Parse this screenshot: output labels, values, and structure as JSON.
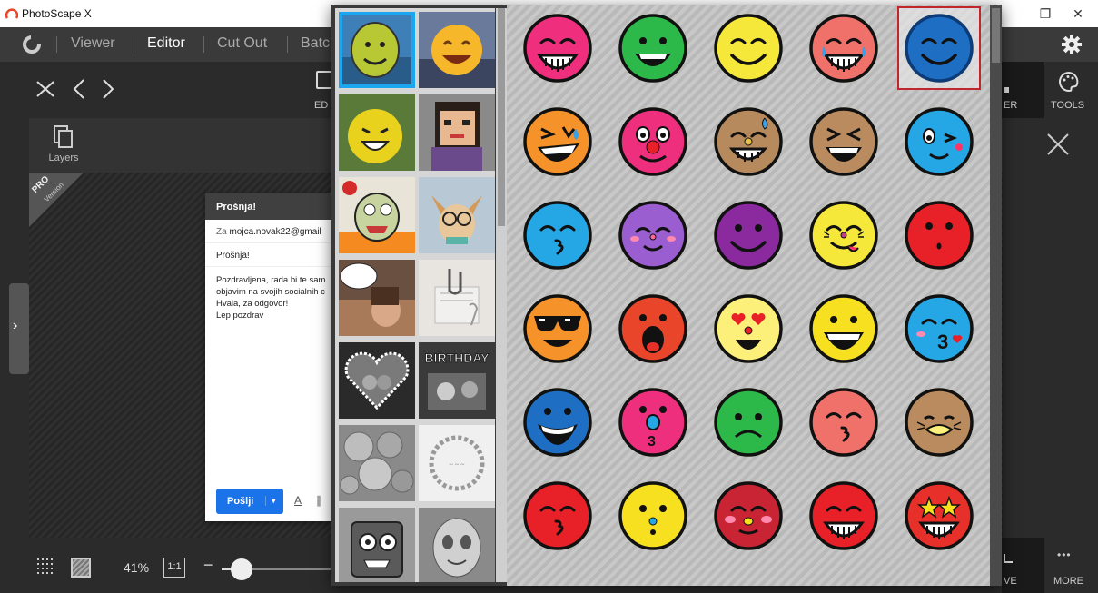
{
  "titlebar": {
    "title": "PhotoScape X",
    "restore": "❐",
    "close": "✕"
  },
  "nav": {
    "tabs": [
      "Viewer",
      "Editor",
      "Cut Out",
      "Batc"
    ]
  },
  "toolbar": {
    "edit_label": "ED",
    "filter_label": "ER",
    "tools_label": "TOOLS"
  },
  "layers_label": "Layers",
  "pro": {
    "text": "PRO",
    "sub": "Version"
  },
  "email": {
    "header": "Prošnja!",
    "to_prefix": "Za",
    "to": "mojca.novak22@gmail",
    "subject": "Prošnja!",
    "body": [
      "Pozdravljena, rada bi te sam",
      "objavim na svojih socialnih c",
      "Hvala, za odgovor!",
      "Lep pozdrav"
    ],
    "send_label": "Pošlji",
    "send_caret": "▾",
    "format_icon": "A",
    "attach_icon": "📎"
  },
  "bottombar": {
    "zoom": "41%",
    "one_to_one": "1:1",
    "minus": "−",
    "save_label": "VE",
    "more_label": "MORE",
    "more_dots": "•••"
  },
  "slider": {
    "value_percent": 18
  },
  "categories": [
    {
      "id": "smiley-blue-bg",
      "selected": true
    },
    {
      "id": "smiley-sunset"
    },
    {
      "id": "smiley-green"
    },
    {
      "id": "pixel-girl"
    },
    {
      "id": "crazy-cartoon"
    },
    {
      "id": "dog-glasses"
    },
    {
      "id": "speech-bubble-photo"
    },
    {
      "id": "paper-clip"
    },
    {
      "id": "heart-frame"
    },
    {
      "id": "birthday"
    },
    {
      "id": "bubbles"
    },
    {
      "id": "wreath"
    },
    {
      "id": "monster"
    },
    {
      "id": "egg-face"
    }
  ],
  "emojis": [
    {
      "name": "grin-pink",
      "fill": "#ef2f7d",
      "ring": "#111",
      "face": "grin-closed"
    },
    {
      "name": "grin-green",
      "fill": "#2db84a",
      "ring": "#111",
      "face": "grin-open"
    },
    {
      "name": "smile-yellow",
      "fill": "#f6e83a",
      "ring": "#111",
      "face": "smile-closed"
    },
    {
      "name": "tears-coral",
      "fill": "#f0706a",
      "ring": "#111",
      "face": "tears"
    },
    {
      "name": "smile-blue",
      "fill": "#1e6fc4",
      "ring": "#0c3b78",
      "face": "smile-closed",
      "selected": true
    },
    {
      "name": "laugh-orange",
      "fill": "#f5922a",
      "ring": "#111",
      "face": "laugh-tilt"
    },
    {
      "name": "clown-pink",
      "fill": "#ee2f7d",
      "ring": "#111",
      "face": "clown"
    },
    {
      "name": "sweat-tan",
      "fill": "#b78a5d",
      "ring": "#111",
      "face": "sweat"
    },
    {
      "name": "squint-tan",
      "fill": "#b98b5f",
      "ring": "#111",
      "face": "squint-laugh"
    },
    {
      "name": "wink-cyan",
      "fill": "#25a7e5",
      "ring": "#111",
      "face": "wink"
    },
    {
      "name": "kiss-cyan",
      "fill": "#25a7e5",
      "ring": "#111",
      "face": "kiss-closed"
    },
    {
      "name": "blush-purple",
      "fill": "#9b5ed1",
      "ring": "#111",
      "face": "blush"
    },
    {
      "name": "smile-violet",
      "fill": "#8a2a9e",
      "ring": "#111",
      "face": "smile-dots"
    },
    {
      "name": "tongue-yellow",
      "fill": "#f6e83a",
      "ring": "#111",
      "face": "tongue"
    },
    {
      "name": "surprise-red",
      "fill": "#e82027",
      "ring": "#111",
      "face": "small-o"
    },
    {
      "name": "cool-orange",
      "fill": "#f5922a",
      "ring": "#111",
      "face": "sunglasses"
    },
    {
      "name": "shout-red",
      "fill": "#e8452a",
      "ring": "#111",
      "face": "shout"
    },
    {
      "name": "love-cream",
      "fill": "#fdf07a",
      "ring": "#111",
      "face": "heart-eyes"
    },
    {
      "name": "happy-yellow",
      "fill": "#f6e020",
      "ring": "#111",
      "face": "happy-open"
    },
    {
      "name": "kiss-heart-cyan",
      "fill": "#25a7e5",
      "ring": "#111",
      "face": "kiss-heart"
    },
    {
      "name": "yell-blue",
      "fill": "#1e6fc4",
      "ring": "#111",
      "face": "yell"
    },
    {
      "name": "kiss-pink",
      "fill": "#ee2f7d",
      "ring": "#111",
      "face": "kiss-nose"
    },
    {
      "name": "sad-green",
      "fill": "#2db84a",
      "ring": "#111",
      "face": "sad"
    },
    {
      "name": "kiss-coral",
      "fill": "#f0706a",
      "ring": "#111",
      "face": "kiss-closed"
    },
    {
      "name": "duck-tan",
      "fill": "#b98b5f",
      "ring": "#111",
      "face": "duck"
    },
    {
      "name": "kiss-red",
      "fill": "#e82027",
      "ring": "#111",
      "face": "kiss-closed"
    },
    {
      "name": "whistle-yellow",
      "fill": "#f6e020",
      "ring": "#111",
      "face": "whistle"
    },
    {
      "name": "blush-crimson",
      "fill": "#c82434",
      "ring": "#111",
      "face": "blush-closed"
    },
    {
      "name": "grin-red",
      "fill": "#e82027",
      "ring": "#111",
      "face": "grin-closed"
    },
    {
      "name": "star-eyes-red",
      "fill": "#e8302a",
      "ring": "#111",
      "face": "star-eyes"
    }
  ]
}
